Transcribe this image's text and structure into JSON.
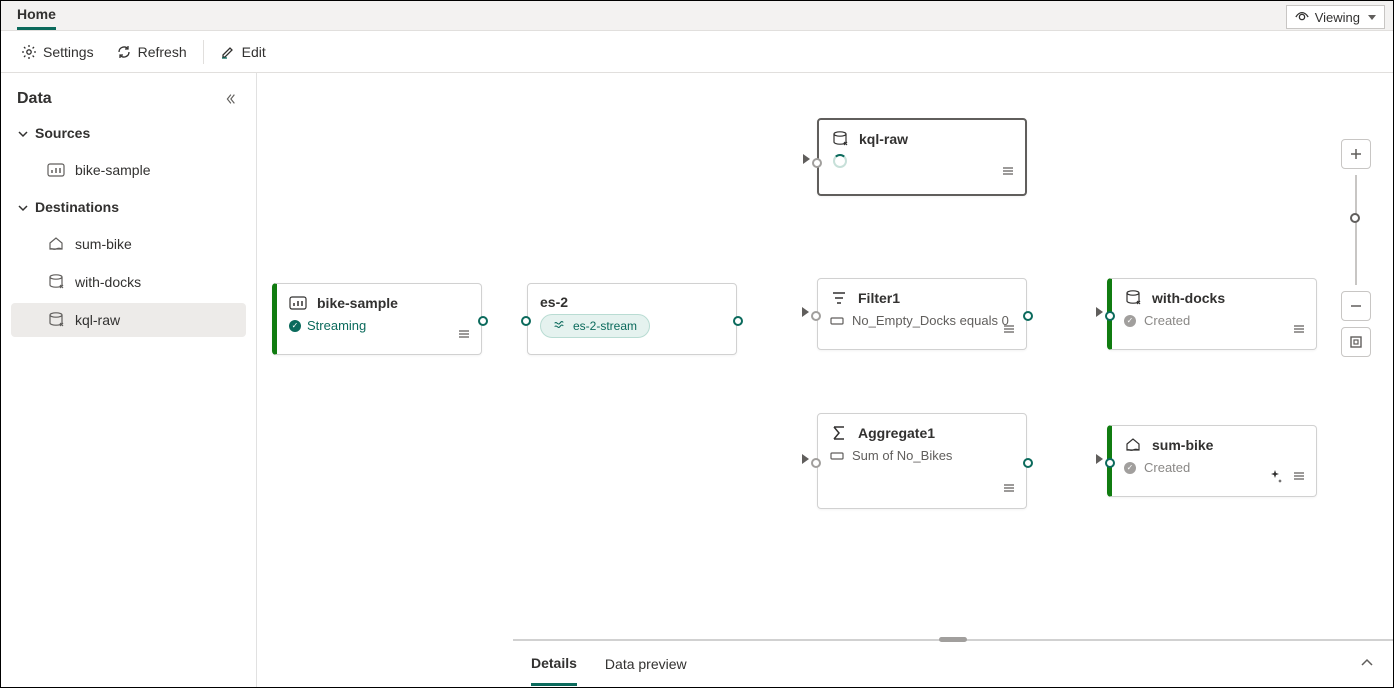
{
  "tabs": {
    "home": "Home"
  },
  "view_mode": {
    "label": "Viewing"
  },
  "toolbar": {
    "settings": "Settings",
    "refresh": "Refresh",
    "edit": "Edit"
  },
  "sidebar": {
    "title": "Data",
    "sections": [
      {
        "label": "Sources",
        "items": [
          {
            "label": "bike-sample",
            "icon": "chart-icon",
            "active": false
          }
        ]
      },
      {
        "label": "Destinations",
        "items": [
          {
            "label": "sum-bike",
            "icon": "lakehouse-icon",
            "active": false
          },
          {
            "label": "with-docks",
            "icon": "database-icon",
            "active": false
          },
          {
            "label": "kql-raw",
            "icon": "database-icon",
            "active": true
          }
        ]
      }
    ]
  },
  "nodes": {
    "bike_sample": {
      "title": "bike-sample",
      "status": "Streaming"
    },
    "es2": {
      "title": "es-2",
      "tag": "es-2-stream"
    },
    "kql_raw": {
      "title": "kql-raw"
    },
    "filter1": {
      "title": "Filter1",
      "desc": "No_Empty_Docks equals 0"
    },
    "aggregate1": {
      "title": "Aggregate1",
      "desc": "Sum of No_Bikes"
    },
    "with_docks": {
      "title": "with-docks",
      "status": "Created"
    },
    "sum_bike": {
      "title": "sum-bike",
      "status": "Created"
    }
  },
  "bottom": {
    "details": "Details",
    "preview": "Data preview"
  }
}
